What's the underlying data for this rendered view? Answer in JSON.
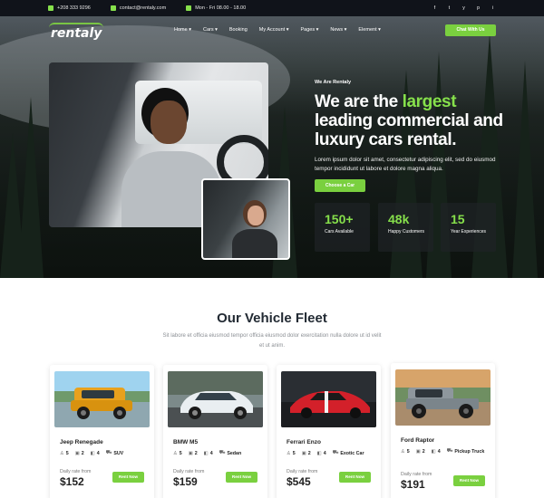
{
  "topbar": {
    "phone": "+208 333 9296",
    "email": "contact@rentaly.com",
    "hours": "Mon - Fri 08.00 - 18.00",
    "social": [
      "f",
      "t",
      "y",
      "p",
      "i"
    ]
  },
  "brand": {
    "name": "rentaly"
  },
  "nav": {
    "items": [
      "Home ▾",
      "Cars ▾",
      "Booking",
      "My Account ▾",
      "Pages ▾",
      "News ▾",
      "Element ▾"
    ],
    "cta": "Chat With Us"
  },
  "hero": {
    "tagline": "We Are Rentaly",
    "headline_pre": "We are the ",
    "headline_accent": "largest",
    "headline_post": " leading commercial and luxury cars rental.",
    "intro": "Lorem ipsum dolor sit amet, consectetur adipiscing elit, sed do eiusmod tempor incididunt ut labore et dolore magna aliqua.",
    "button": "Choose a Car",
    "stats": [
      {
        "value": "150+",
        "label": "Cars Available"
      },
      {
        "value": "48k",
        "label": "Happy Customers"
      },
      {
        "value": "15",
        "label": "Year Experiences"
      }
    ]
  },
  "fleet": {
    "title": "Our Vehicle Fleet",
    "subtitle": "Sit labore et officia eiusmod tempor officia eiusmod dolor exercitation nulla dolore ut id velit et ut anim.",
    "cards": [
      {
        "name": "Jeep Renegade",
        "seats": "5",
        "bags": "2",
        "doors": "4",
        "type": "SUV",
        "rate_label": "Daily rate from",
        "price": "$152",
        "button": "Rent Now"
      },
      {
        "name": "BMW M5",
        "seats": "5",
        "bags": "2",
        "doors": "4",
        "type": "Sedan",
        "rate_label": "Daily rate from",
        "price": "$159",
        "button": "Rent Now"
      },
      {
        "name": "Ferrari Enzo",
        "seats": "5",
        "bags": "2",
        "doors": "4",
        "type": "Exotic Car",
        "rate_label": "Daily rate from",
        "price": "$545",
        "button": "Rent Now"
      },
      {
        "name": "Ford Raptor",
        "seats": "5",
        "bags": "2",
        "doors": "4",
        "type": "Pickup Truck",
        "rate_label": "Daily rate from",
        "price": "$191",
        "button": "Rent Now"
      }
    ]
  },
  "colors": {
    "accent": "#7ad03f",
    "topbar": "#10131a"
  }
}
